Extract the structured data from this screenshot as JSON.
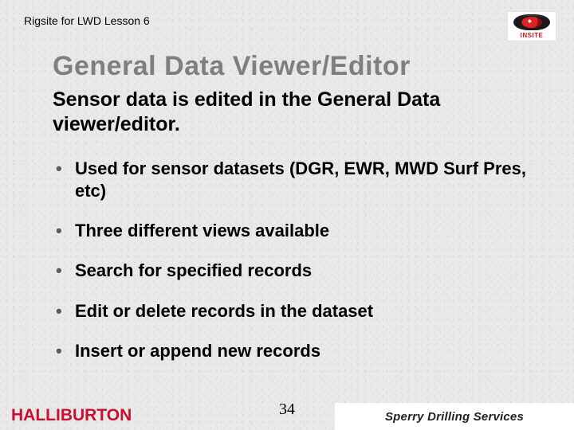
{
  "header": {
    "lesson": "Rigsite for LWD Lesson 6"
  },
  "logos": {
    "insite": "INSITE",
    "halliburton": "HALLIBURTON",
    "sperry": "Sperry Drilling Services"
  },
  "title": "General Data Viewer/Editor",
  "subtitle": "Sensor data is edited in the General Data viewer/editor.",
  "bullets": [
    "Used for sensor datasets (DGR, EWR, MWD Surf Pres, etc)",
    "Three different views available",
    "Search for specified records",
    "Edit or delete records in the dataset",
    "Insert or append new records"
  ],
  "page_number": "34"
}
